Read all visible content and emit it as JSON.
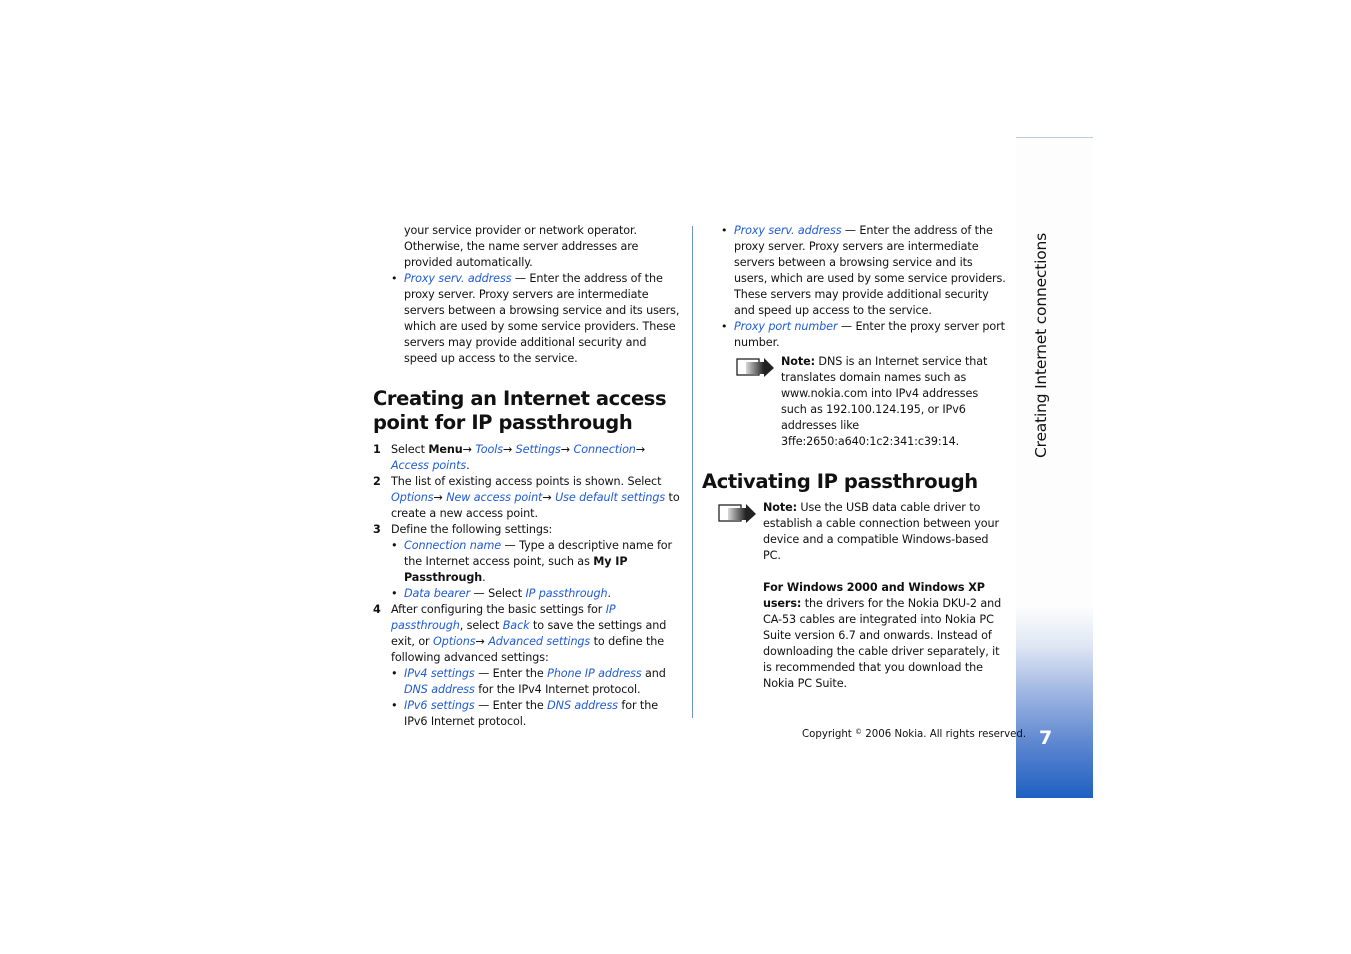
{
  "sidebar": {
    "chapter_title": "Creating Internet connections",
    "page_number": "7"
  },
  "footer": {
    "copyright_prefix": "Copyright",
    "copyright_symbol": "©",
    "copyright_suffix": "2006 Nokia. All rights reserved."
  },
  "left": {
    "intro_lines": "your service provider or network operator. Otherwise, the name server addresses are provided automatically.",
    "proxy_bullet": {
      "link": "Proxy serv. address",
      "text": " — Enter the address of the proxy server. Proxy servers are intermediate servers between a browsing service and its users, which are used by some service providers. These servers may provide additional security and speed up access to the service."
    },
    "heading": "Creating an Internet access point for IP passthrough",
    "steps": {
      "s1": {
        "num": "1",
        "t1": "Select ",
        "menu": "Menu",
        "arrow": "→ ",
        "tools": "Tools",
        "settings": "Settings",
        "connection": "Connection",
        "access_points": "Access points",
        "end": "."
      },
      "s2": {
        "num": "2",
        "t1": "The list of existing access points is shown. Select ",
        "options": "Options",
        "new_ap": "New access point",
        "use_default": "Use default settings",
        "t2": " to create a new access point."
      },
      "s3": {
        "num": "3",
        "t1": "Define the following settings:",
        "b1_link": "Connection name",
        "b1_text": " — Type a descriptive name for the Internet access point, such as ",
        "b1_bold": "My IP Passthrough",
        "b1_end": ".",
        "b2_link": "Data bearer",
        "b2_text": " — Select ",
        "b2_link2": "IP passthrough",
        "b2_end": "."
      },
      "s4": {
        "num": "4",
        "t1": "After configuring the basic settings for ",
        "ip_passthrough": "IP passthrough",
        "t2": ", select ",
        "back": "Back",
        "t3": " to save the settings and exit, or ",
        "options": "Options",
        "arrow": "→",
        "advanced": "Advanced settings",
        "t4": " to define the following advanced settings:",
        "b1_link": "IPv4 settings",
        "b1_t1": " — Enter the ",
        "b1_phone_ip": "Phone IP address",
        "b1_t2": " and ",
        "b1_dns": "DNS address",
        "b1_t3": " for the IPv4 Internet protocol.",
        "b2_link": "IPv6 settings",
        "b2_t1": " — Enter the ",
        "b2_dns": "DNS address",
        "b2_t2": " for the IPv6 Internet protocol."
      }
    }
  },
  "right": {
    "proxy_bullet": {
      "link": "Proxy serv. address",
      "text": " — Enter the address of the proxy server. Proxy servers are intermediate servers between a browsing service and its users, which are used by some service providers. These servers may provide additional security and speed up access to the service."
    },
    "port_bullet": {
      "link": "Proxy port number",
      "text": " — Enter the proxy server port number."
    },
    "dns_note": {
      "label": "Note:",
      "text": " DNS is an Internet service that translates domain names such as www.nokia.com into IPv4 addresses such as 192.100.124.195, or IPv6 addresses like 3ffe:2650:a640:1c2:341:c39:14."
    },
    "heading": "Activating IP passthrough",
    "usb_note": {
      "label": "Note:",
      "text": " Use the USB data cable driver to establish a cable connection between your device and a compatible Windows-based PC.",
      "windows_label": "For Windows 2000 and Windows XP users:",
      "windows_text": " the drivers for the Nokia DKU-2 and CA-53 cables are integrated into Nokia PC Suite version 6.7 and onwards. Instead of downloading the cable driver separately, it is recommended that you download the Nokia PC Suite."
    }
  }
}
